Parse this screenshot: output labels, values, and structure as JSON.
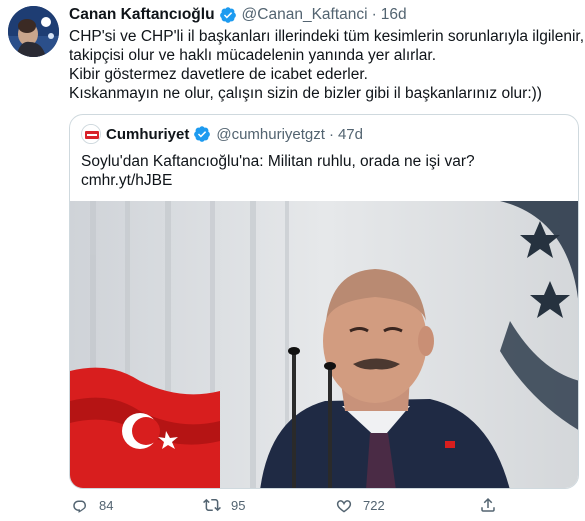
{
  "tweet": {
    "author_name": "Canan Kaftancıoğlu",
    "author_handle": "@Canan_Kaftanci",
    "separator": "·",
    "time": "16d",
    "lines": [
      "CHP'si ve CHP'li il başkanları illerindeki tüm kesimlerin sorunlarıyla ilgilenir,",
      "takipçisi olur ve haklı mücadelenin yanında yer alırlar.",
      "Kibir göstermez davetlere de icabet ederler.",
      "Kıskanmayın ne olur, çalışın sizin de bizler gibi il başkanlarınız olur:))"
    ]
  },
  "quote": {
    "author_name": "Cumhuriyet",
    "author_handle": "@cumhuriyetgzt",
    "separator": "·",
    "time": "47d",
    "lines": [
      "Soylu'dan Kaftancıoğlu'na: Militan ruhlu, orada ne işi var?",
      "cmhr.yt/hJBE"
    ]
  },
  "actions": {
    "reply_count": "84",
    "retweet_count": "95",
    "like_count": "722"
  },
  "colors": {
    "verified": "#1d9bf0",
    "text": "#0f1419",
    "secondary": "#536471",
    "border": "#cfd9de"
  },
  "icons": {
    "verified": "verified-badge-icon",
    "reply": "reply-icon",
    "retweet": "retweet-icon",
    "like": "heart-icon",
    "share": "share-icon"
  }
}
